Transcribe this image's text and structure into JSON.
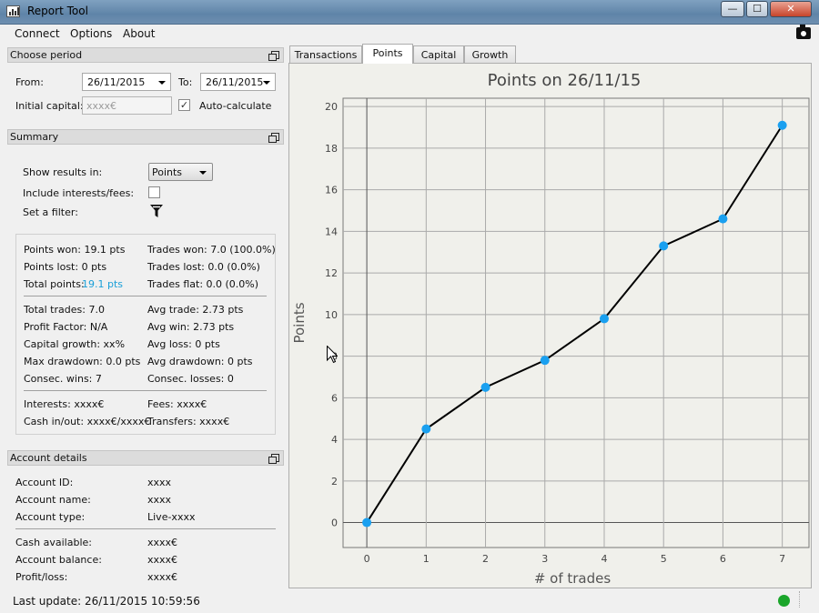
{
  "window": {
    "title": "Report Tool",
    "minimize": "—",
    "maximize": "☐",
    "close": "✕"
  },
  "menu": [
    "Connect",
    "Options",
    "About"
  ],
  "choose_period": {
    "header": "Choose period",
    "from_label": "From:",
    "from_value": "26/11/2015",
    "to_label": "To:",
    "to_value": "26/11/2015",
    "capital_label": "Initial capital:",
    "capital_placeholder": "xxxx€",
    "auto_label": "Auto-calculate",
    "auto_checked": "✓"
  },
  "summary": {
    "header": "Summary",
    "show_results_label": "Show results in:",
    "show_results_value": "Points",
    "interests_label": "Include interests/fees:",
    "filter_label": "Set a filter:",
    "stats_left": [
      "Points won: 19.1 pts",
      "Points lost: 0 pts",
      "Total points:",
      "Total trades: 7.0",
      "Profit Factor: N/A",
      "Capital growth: xx%",
      "Max drawdown: 0.0 pts",
      "Consec. wins: 7",
      "Interests: xxxx€",
      "Cash in/out: xxxx€/xxxx€"
    ],
    "total_points_value": "19.1 pts",
    "stats_right": [
      "Trades won: 7.0 (100.0%)",
      "Trades lost: 0.0 (0.0%)",
      "Trades flat: 0.0 (0.0%)",
      "Avg trade: 2.73 pts",
      "Avg win: 2.73 pts",
      "Avg loss: 0 pts",
      "Avg drawdown: 0 pts",
      "Consec. losses: 0",
      "Fees: xxxx€",
      "Transfers: xxxx€"
    ]
  },
  "account": {
    "header": "Account details",
    "rows": [
      {
        "label": "Account ID:",
        "value": "xxxx"
      },
      {
        "label": "Account name:",
        "value": "xxxx"
      },
      {
        "label": "Account type:",
        "value": "Live-xxxx"
      },
      {
        "label": "Cash available:",
        "value": "xxxx€"
      },
      {
        "label": "Account balance:",
        "value": "xxxx€"
      },
      {
        "label": "Profit/loss:",
        "value": "xxxx€"
      }
    ]
  },
  "tabs": [
    "Transactions",
    "Points",
    "Capital",
    "Growth"
  ],
  "active_tab": "Points",
  "status": {
    "last_update": "Last update: 26/11/2015 10:59:56",
    "connection_color": "#1aa52a"
  },
  "colors": {
    "point": "#1aa0f0",
    "line": "#000000",
    "link": "#1a9fd8"
  },
  "chart_data": {
    "type": "line",
    "title": "Points on 26/11/15",
    "xlabel": "# of trades",
    "ylabel": "Points",
    "x": [
      0,
      1,
      2,
      3,
      4,
      5,
      6,
      7
    ],
    "y": [
      0,
      4.5,
      6.5,
      7.8,
      9.8,
      13.3,
      14.6,
      19.1
    ],
    "xlim": [
      -0.4,
      7.45
    ],
    "ylim": [
      -1.2,
      20.4
    ],
    "xticks": [
      "0",
      "1",
      "2",
      "3",
      "4",
      "5",
      "6",
      "7"
    ],
    "yticks": [
      "0",
      "2",
      "4",
      "6",
      "8",
      "10",
      "12",
      "14",
      "16",
      "18",
      "20"
    ],
    "grid": true
  }
}
